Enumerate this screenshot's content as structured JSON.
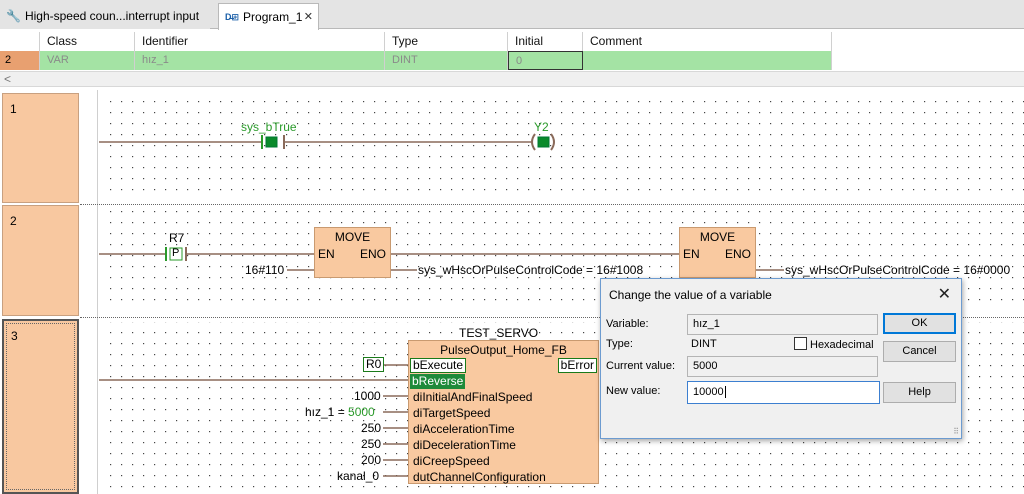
{
  "tabs": [
    {
      "label": "High-speed coun...interrupt input",
      "icon": "wrench-icon",
      "active": false
    },
    {
      "label": "Program_1",
      "icon": "ladder-program-icon",
      "active": true
    }
  ],
  "var_table": {
    "headers": [
      "Class",
      "Identifier",
      "Type",
      "Initial",
      "Comment"
    ],
    "row": {
      "num": "2",
      "class": "VAR",
      "identifier": "hız_1",
      "type": "DINT",
      "initial": "0",
      "comment": ""
    }
  },
  "scroll_left_glyph": "<",
  "networks": [
    {
      "number": "1",
      "contact": "sys_bTrue",
      "coil": "Y2"
    },
    {
      "number": "2",
      "contact": "R7",
      "contact_symbol": "P",
      "block1": {
        "title": "MOVE",
        "en": "EN",
        "eno": "ENO",
        "input": "16#110",
        "output": "sys_wHscOrPulseControlCode = 16#1008"
      },
      "block2": {
        "title": "MOVE",
        "en": "EN",
        "eno": "ENO",
        "output": "sys_wHscOrPulseControlCode = 16#0000"
      }
    },
    {
      "number": "3",
      "instance": "TEST_SERVO",
      "fb_type": "PulseOutput_Home_FB",
      "execute_var": "R0",
      "pins_in": [
        {
          "name": "bExecute",
          "value": "R0"
        },
        {
          "name": "bReverse",
          "value": ""
        },
        {
          "name": "diInitialAndFinalSpeed",
          "value": "1000"
        },
        {
          "name": "diTargetSpeed",
          "value": "hız_1 = 5000"
        },
        {
          "name": "diAccelerationTime",
          "value": "250"
        },
        {
          "name": "diDecelerationTime",
          "value": "250"
        },
        {
          "name": "diCreepSpeed",
          "value": "200"
        },
        {
          "name": "dutChannelConfiguration",
          "value": "kanal_0"
        }
      ],
      "pin_out": "bError",
      "target_prefix": "hız_1 = ",
      "target_value": "5000"
    }
  ],
  "dialog": {
    "title": "Change the value of a variable",
    "variable_label": "Variable:",
    "variable": "hız_1",
    "type_label": "Type:",
    "type": "DINT",
    "hex_label": "Hexadecimal",
    "hex_checked": false,
    "current_label": "Current value:",
    "current": "5000",
    "new_label": "New value:",
    "new_value": "10000",
    "ok": "OK",
    "cancel": "Cancel",
    "help": "Help"
  },
  "colors": {
    "network_cell": "#f8c8a0",
    "active_row": "#a4e3a4",
    "contact_green": "#2a9a2a",
    "accent": "#0078d7"
  }
}
